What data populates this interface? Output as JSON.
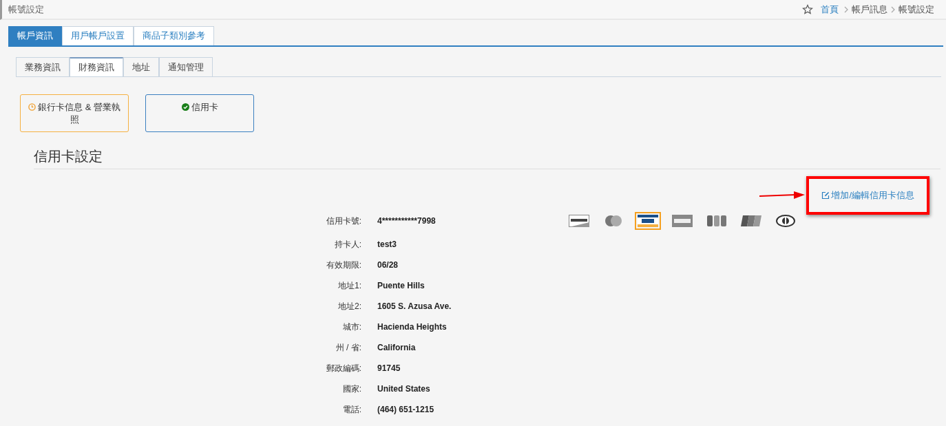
{
  "page_title": "帳號設定",
  "breadcrumb": [
    {
      "label": "首頁",
      "link": true
    },
    {
      "label": "帳戶訊息",
      "link": false
    },
    {
      "label": "帳號設定",
      "link": false
    }
  ],
  "tabs": [
    {
      "label": "帳戶資訊",
      "selected": true
    },
    {
      "label": "用戶帳戶設置",
      "selected": false
    },
    {
      "label": "商品子類別參考",
      "selected": false
    }
  ],
  "subtabs": [
    {
      "label": "業務資訊",
      "selected": false
    },
    {
      "label": "財務資訊",
      "selected": true
    },
    {
      "label": "地址",
      "selected": false
    },
    {
      "label": "通知管理",
      "selected": false
    }
  ],
  "status_cards": [
    {
      "label": "銀行卡信息 & 營業執照",
      "complete": false
    },
    {
      "label": "信用卡",
      "complete": true
    }
  ],
  "section_title": "信用卡設定",
  "edit_link": {
    "label": "增加/編輯信用卡信息",
    "highlighted": true
  },
  "card_logos": [
    {
      "kind": "discover",
      "selected": false
    },
    {
      "kind": "mastercard",
      "selected": false
    },
    {
      "kind": "visa",
      "selected": true
    },
    {
      "kind": "amex",
      "selected": false
    },
    {
      "kind": "jcb",
      "selected": false
    },
    {
      "kind": "unionpay",
      "selected": false
    },
    {
      "kind": "diners",
      "selected": false
    }
  ],
  "details": [
    {
      "label": "信用卡號:",
      "value": "4***********7998"
    },
    {
      "label": "持卡人:",
      "value": "test3"
    },
    {
      "label": "有效期限:",
      "value": "06/28"
    },
    {
      "label": "地址1:",
      "value": "Puente Hills"
    },
    {
      "label": "地址2:",
      "value": "1605 S. Azusa Ave."
    },
    {
      "label": "城市:",
      "value": "Hacienda Heights"
    },
    {
      "label": "州 / 省:",
      "value": "California"
    },
    {
      "label": "郵政編碼:",
      "value": "91745"
    },
    {
      "label": "國家:",
      "value": "United States"
    },
    {
      "label": "電話:",
      "value": "(464) 651-1215"
    }
  ]
}
